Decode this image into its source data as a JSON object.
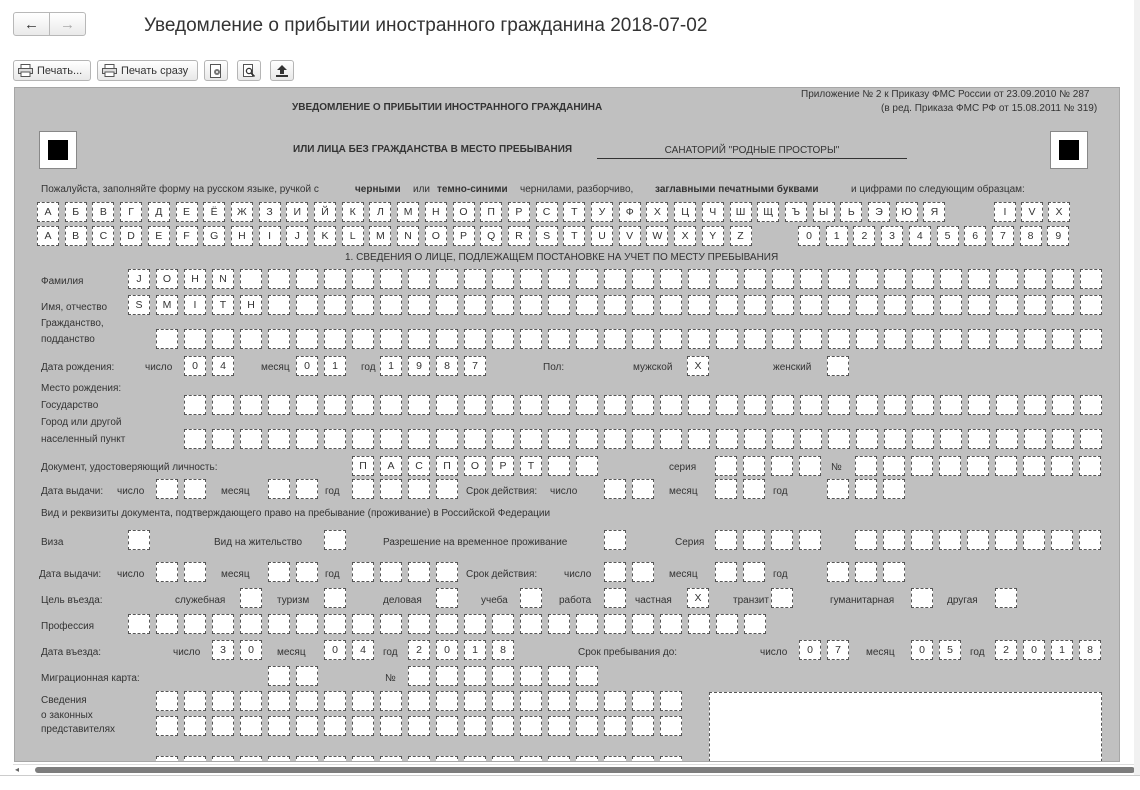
{
  "window": {
    "title": "Уведомление о прибытии иностранного гражданина 2018-07-02",
    "back_icon": "←",
    "forward_icon": "→"
  },
  "toolbar": {
    "print_label": "Печать...",
    "print_now_label": "Печать сразу"
  },
  "form": {
    "appendix_line1": "Приложение № 2 к Приказу ФМС России от 23.09.2010 № 287",
    "appendix_line2": "(в ред. Приказа ФМС РФ от 15.08.2011 № 319)",
    "heading_line1": "УВЕДОМЛЕНИЕ О ПРИБЫТИИ ИНОСТРАННОГО ГРАЖДАНИНА",
    "heading_line2": "ИЛИ ЛИЦА БЕЗ ГРАЖДАНСТВА В МЕСТО ПРЕБЫВАНИЯ",
    "place_name": "САНАТОРИЙ \"РОДНЫЕ ПРОСТОРЫ\"",
    "instructions": [
      "Пожалуйста, заполняйте форму на русском языке, ручкой с",
      "черными",
      "или",
      "темно-синими",
      "чернилами, разборчиво,",
      "заглавными печатными буквами",
      "и цифрами по следующим образцам:"
    ],
    "sample_cyrillic": [
      "А",
      "Б",
      "В",
      "Г",
      "Д",
      "Е",
      "Ё",
      "Ж",
      "З",
      "И",
      "Й",
      "К",
      "Л",
      "М",
      "Н",
      "О",
      "П",
      "Р",
      "С",
      "Т",
      "У",
      "Ф",
      "Х",
      "Ц",
      "Ч",
      "Ш",
      "Щ",
      "Ъ",
      "Ы",
      "Ь",
      "Э",
      "Ю",
      "Я"
    ],
    "sample_roman": [
      "I",
      "V",
      "X"
    ],
    "sample_latin": [
      "A",
      "B",
      "C",
      "D",
      "E",
      "F",
      "G",
      "H",
      "I",
      "J",
      "K",
      "L",
      "M",
      "N",
      "O",
      "P",
      "Q",
      "R",
      "S",
      "T",
      "U",
      "V",
      "W",
      "X",
      "Y",
      "Z"
    ],
    "sample_digits": [
      "0",
      "1",
      "2",
      "3",
      "4",
      "5",
      "6",
      "7",
      "8",
      "9"
    ],
    "section1_title": "1. СВЕДЕНИЯ О ЛИЦЕ, ПОДЛЕЖАЩЕМ ПОСТАНОВКЕ НА УЧЕТ ПО МЕСТУ ПРЕБЫВАНИЯ",
    "labels": {
      "surname": "Фамилия",
      "name": "Имя, отчество",
      "citizenship_1": "Гражданство,",
      "citizenship_2": "подданство",
      "birth_date": "Дата рождения:",
      "day": "число",
      "month": "месяц",
      "year": "год",
      "sex": "Пол:",
      "male": "мужской",
      "female": "женский",
      "birth_place": "Место рождения:",
      "state": "Государство",
      "city_1": "Город или другой",
      "city_2": "населенный пункт",
      "id_doc": "Документ, удостоверяющий личность:",
      "series": "серия",
      "number_sign": "№",
      "issue_date": "Дата выдачи:",
      "valid_until": "Срок действия:",
      "permit_doc": "Вид и реквизиты документа, подтверждающего право на пребывание (проживание) в Российской Федерации",
      "visa": "Виза",
      "residence_permit": "Вид на жительство",
      "temp_residence": "Разрешение на временное проживание",
      "series_cap": "Серия",
      "purpose": "Цель въезда:",
      "purpose_service": "служебная",
      "purpose_tourism": "туризм",
      "purpose_business": "деловая",
      "purpose_study": "учеба",
      "purpose_work": "работа",
      "purpose_private": "частная",
      "purpose_transit": "транзит",
      "purpose_humanitarian": "гуманитарная",
      "purpose_other": "другая",
      "profession": "Профессия",
      "entry_date": "Дата въезда:",
      "stay_until": "Срок пребывания до:",
      "migration_card": "Миграционная карта:",
      "legal_reps_1": "Сведения",
      "legal_reps_2": "о законных",
      "legal_reps_3": "представителях"
    },
    "values": {
      "surname": "JOHN",
      "name": "SMITH",
      "birth_day": "04",
      "birth_month": "01",
      "birth_year": "1987",
      "sex_male_mark": "X",
      "id_doc": "ПАСПОРТ",
      "purpose_private_mark": "X",
      "entry_day": "30",
      "entry_month": "04",
      "entry_year": "2018",
      "stay_day": "07",
      "stay_month": "05",
      "stay_year": "2018"
    }
  }
}
